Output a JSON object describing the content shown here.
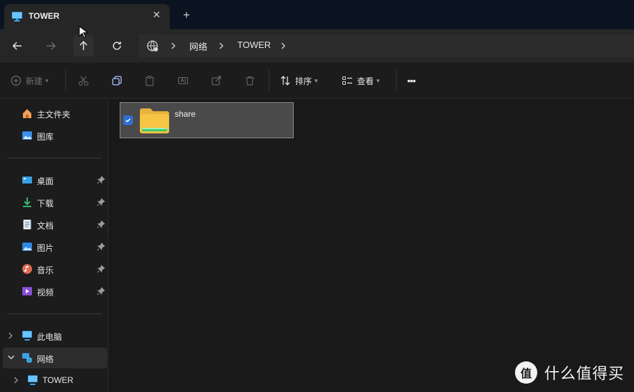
{
  "tab": {
    "title": "TOWER",
    "close": "✕",
    "new_tab": "+"
  },
  "nav": {
    "back_icon": "arrow-left-icon",
    "forward_icon": "arrow-right-icon",
    "up_icon": "arrow-up-icon",
    "refresh_icon": "refresh-icon"
  },
  "address": {
    "crumbs": [
      "网络",
      "TOWER"
    ]
  },
  "toolbar": {
    "new_label": "新建",
    "sort_label": "排序",
    "view_label": "查看",
    "more": "•••"
  },
  "sidebar": {
    "top": [
      {
        "label": "主文件夹",
        "icon": "home-icon"
      },
      {
        "label": "图库",
        "icon": "gallery-icon"
      }
    ],
    "pinned": [
      {
        "label": "桌面",
        "icon": "desktop-icon"
      },
      {
        "label": "下载",
        "icon": "download-icon"
      },
      {
        "label": "文档",
        "icon": "document-icon"
      },
      {
        "label": "图片",
        "icon": "pictures-icon"
      },
      {
        "label": "音乐",
        "icon": "music-icon"
      },
      {
        "label": "视频",
        "icon": "video-icon"
      }
    ],
    "bottom": [
      {
        "label": "此电脑",
        "icon": "pc-icon"
      },
      {
        "label": "网络",
        "icon": "network-icon"
      },
      {
        "label": "TOWER",
        "icon": "pc-icon"
      }
    ]
  },
  "content": {
    "items": [
      {
        "name": "share",
        "icon": "folder-icon",
        "selected": true
      }
    ]
  },
  "watermark": {
    "badge": "值",
    "text": "什么值得买"
  },
  "colors": {
    "accent": "#2f6fd0",
    "folder": "#f6c544",
    "selection_bg": "#4a4a4a"
  }
}
